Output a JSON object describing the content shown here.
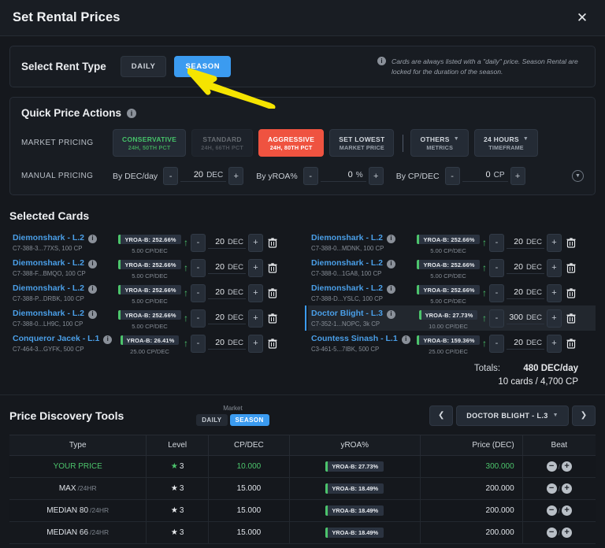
{
  "header": {
    "title": "Set Rental Prices",
    "close_icon": "close-icon"
  },
  "rent_type": {
    "label": "Select Rent Type",
    "options": [
      {
        "label": "DAILY",
        "active": false
      },
      {
        "label": "SEASON",
        "active": true
      }
    ],
    "note": "Cards are always listed with a \"daily\" price. Season Rental are locked for the duration of the season."
  },
  "quick_price": {
    "title": "Quick Price Actions",
    "market_label": "MARKET PRICING",
    "market_buttons": [
      {
        "t1": "CONSERVATIVE",
        "t2": "24H, 50TH PCT",
        "style": "conservative"
      },
      {
        "t1": "STANDARD",
        "t2": "24H, 66TH PCT",
        "style": "standard"
      },
      {
        "t1": "AGGRESSIVE",
        "t2": "24H, 80TH PCT",
        "style": "aggressive"
      },
      {
        "t1": "SET LOWEST",
        "t2": "MARKET PRICE",
        "style": "plain"
      }
    ],
    "dropdowns": [
      {
        "t1": "OTHERS",
        "t2": "METRICS"
      },
      {
        "t1": "24 HOURS",
        "t2": "TIMEFRAME"
      }
    ],
    "manual_label": "MANUAL PRICING",
    "manual_groups": [
      {
        "label": "By DEC/day",
        "minus": "-",
        "value": "20",
        "unit": "DEC",
        "plus": "+"
      },
      {
        "label": "By yROA%",
        "minus": "-",
        "value": "0",
        "unit": "%",
        "plus": "+"
      },
      {
        "label": "By CP/DEC",
        "minus": "-",
        "value": "0",
        "unit": "CP",
        "plus": "+"
      }
    ],
    "expand_icon": "chevron-down-circle-icon"
  },
  "selected_cards": {
    "title": "Selected Cards",
    "left": [
      {
        "name": "Diemonshark - L.2",
        "sub": "C7-388-3...77XS, 100 CP",
        "badge": "YROA-B: 252.66%",
        "cpdec": "5.00 CP/DEC",
        "value": "20",
        "unit": "DEC",
        "selected": false
      },
      {
        "name": "Diemonshark - L.2",
        "sub": "C7-388-F...BMQO, 100 CP",
        "badge": "YROA-B: 252.66%",
        "cpdec": "5.00 CP/DEC",
        "value": "20",
        "unit": "DEC",
        "selected": false
      },
      {
        "name": "Diemonshark - L.2",
        "sub": "C7-388-P...DRBK, 100 CP",
        "badge": "YROA-B: 252.66%",
        "cpdec": "5.00 CP/DEC",
        "value": "20",
        "unit": "DEC",
        "selected": false
      },
      {
        "name": "Diemonshark - L.2",
        "sub": "C7-388-0...LH9C, 100 CP",
        "badge": "YROA-B: 252.66%",
        "cpdec": "5.00 CP/DEC",
        "value": "20",
        "unit": "DEC",
        "selected": false
      },
      {
        "name": "Conqueror Jacek - L.1",
        "sub": "C7-464-3...GYFK, 500 CP",
        "badge": "YROA-B: 26.41%",
        "cpdec": "25.00 CP/DEC",
        "value": "20",
        "unit": "DEC",
        "selected": false
      }
    ],
    "right": [
      {
        "name": "Diemonshark - L.2",
        "sub": "C7-388-0...MDNK, 100 CP",
        "badge": "YROA-B: 252.66%",
        "cpdec": "5.00 CP/DEC",
        "value": "20",
        "unit": "DEC",
        "selected": false
      },
      {
        "name": "Diemonshark - L.2",
        "sub": "C7-388-0...1GA8, 100 CP",
        "badge": "YROA-B: 252.66%",
        "cpdec": "5.00 CP/DEC",
        "value": "20",
        "unit": "DEC",
        "selected": false
      },
      {
        "name": "Diemonshark - L.2",
        "sub": "C7-388-D...YSLC, 100 CP",
        "badge": "YROA-B: 252.66%",
        "cpdec": "5.00 CP/DEC",
        "value": "20",
        "unit": "DEC",
        "selected": false
      },
      {
        "name": "Doctor Blight - L.3",
        "sub": "C7-352-1...NOPC, 3k CP",
        "badge": "YROA-B: 27.73%",
        "cpdec": "10.00 CP/DEC",
        "value": "300",
        "unit": "DEC",
        "selected": true
      },
      {
        "name": "Countess Sinash - L.1",
        "sub": "C3-461-5...7IBK, 500 CP",
        "badge": "YROA-B: 159.36%",
        "cpdec": "25.00 CP/DEC",
        "value": "20",
        "unit": "DEC",
        "selected": false
      }
    ],
    "totals_label": "Totals:",
    "totals_value": "480 DEC/day",
    "totals_cards": "10 cards / 4,700 CP"
  },
  "price_discovery": {
    "title": "Price Discovery Tools",
    "market_label": "Market",
    "market_toggle": [
      {
        "label": "DAILY",
        "active": false
      },
      {
        "label": "SEASON",
        "active": true
      }
    ],
    "prev_icon": "chevron-left-icon",
    "next_icon": "chevron-right-icon",
    "card_selector": "DOCTOR BLIGHT - L.3",
    "columns": [
      "Type",
      "Level",
      "CP/DEC",
      "yROA%",
      "Price (DEC)",
      "Beat"
    ],
    "rows": [
      {
        "type": "YOUR PRICE",
        "sub": "",
        "level": "3",
        "cpdec": "10.000",
        "yroa": "YROA-B: 27.73%",
        "price": "300.000",
        "highlight": true
      },
      {
        "type": "MAX",
        "sub": "/24HR",
        "level": "3",
        "cpdec": "15.000",
        "yroa": "YROA-B: 18.49%",
        "price": "200.000",
        "highlight": false
      },
      {
        "type": "MEDIAN 80",
        "sub": "/24HR",
        "level": "3",
        "cpdec": "15.000",
        "yroa": "YROA-B: 18.49%",
        "price": "200.000",
        "highlight": false
      },
      {
        "type": "MEDIAN 66",
        "sub": "/24HR",
        "level": "3",
        "cpdec": "15.000",
        "yroa": "YROA-B: 18.49%",
        "price": "200.000",
        "highlight": false
      }
    ],
    "beat_minus": "−",
    "beat_plus": "+"
  },
  "annotation": {
    "arrow_color": "#f5e400"
  }
}
